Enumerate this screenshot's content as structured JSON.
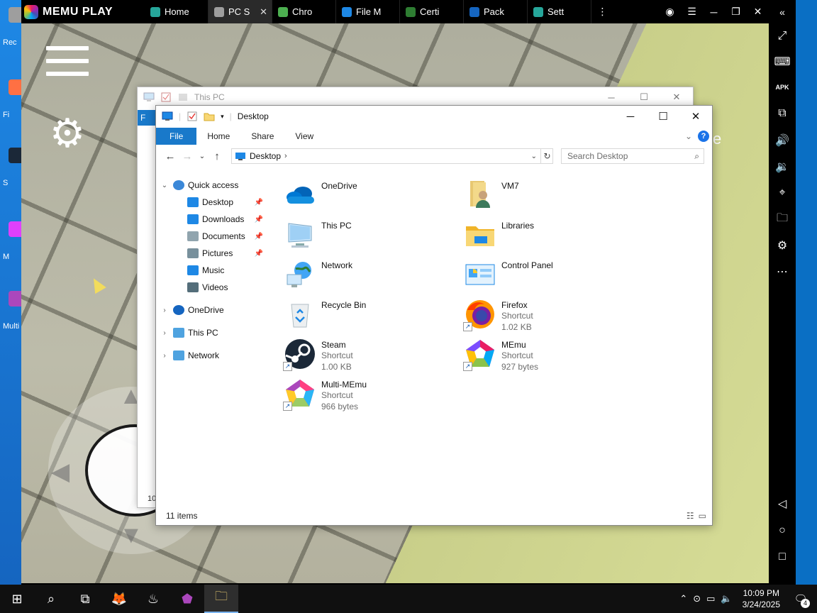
{
  "host_desktop": {
    "icons": [
      {
        "label": "Rec",
        "color": "#9e9e9e"
      },
      {
        "label": "Fi",
        "color": "#ff7043"
      },
      {
        "label": "S",
        "color": "#1b2838"
      },
      {
        "label": "M",
        "color": "#e040fb"
      },
      {
        "label": "Multi",
        "color": "#ab47bc"
      }
    ]
  },
  "memu": {
    "brand": "MEMU PLAY",
    "tabs": [
      {
        "label": "Home",
        "icon": "home-app-icon",
        "color": "#26a69a",
        "active": false
      },
      {
        "label": "PC S",
        "icon": "pc-screen-icon",
        "color": "#9e9e9e",
        "active": true
      },
      {
        "label": "Chro",
        "icon": "chrome-icon",
        "color": "#4caf50",
        "active": false
      },
      {
        "label": "File M",
        "icon": "file-manager-icon",
        "color": "#1e88e5",
        "active": false
      },
      {
        "label": "Certi",
        "icon": "certificate-icon",
        "color": "#2e7d32",
        "active": false
      },
      {
        "label": "Pack",
        "icon": "package-icon",
        "color": "#1565c0",
        "active": false
      },
      {
        "label": "Sett",
        "icon": "settings-app-icon",
        "color": "#26a69a",
        "active": false
      }
    ],
    "close_glyph": "✕",
    "title_buttons": {
      "more": "⋮",
      "account": "◉",
      "menu": "☰",
      "minimize": "─",
      "restore": "❐",
      "close": "✕",
      "collapse": "«"
    },
    "sidebar": [
      "fullscreen-icon",
      "keyboard-icon",
      "apk-icon",
      "multi-window-icon",
      "volume-up-icon",
      "volume-down-icon",
      "location-icon",
      "folder-icon",
      "settings-icon",
      "more-icon",
      "back-icon",
      "home-icon",
      "recents-icon"
    ],
    "sidebar_glyphs": [
      "⤢",
      "⌨",
      "APK",
      "⧉",
      "🔊",
      "🔉",
      "⌖",
      "🗀",
      "⚙",
      "⋯",
      "◁",
      "○",
      "□"
    ]
  },
  "game": {
    "gear": "⚙",
    "ghost_letter": "e"
  },
  "back_window": {
    "title": "This PC",
    "stub_tab": "F",
    "bottom_text": "10",
    "controls": {
      "minimize": "─",
      "maximize": "☐",
      "close": "✕"
    }
  },
  "explorer": {
    "title": "Desktop",
    "controls": {
      "minimize": "─",
      "maximize": "☐",
      "close": "✕"
    },
    "ribbon": {
      "tabs": [
        "File",
        "Home",
        "Share",
        "View"
      ],
      "expand": "⌄",
      "help": "?"
    },
    "nav": {
      "back": "←",
      "forward": "→",
      "recent": "⌄",
      "up": "↑"
    },
    "address": {
      "path": "Desktop",
      "chevron": "›",
      "dropdown": "⌄",
      "refresh": "↻"
    },
    "search": {
      "placeholder": "Search Desktop",
      "icon": "⌕"
    },
    "nav_pane": [
      {
        "label": "Quick access",
        "expander": "⌄",
        "icon": "star-icon",
        "level": 0,
        "pinned": false
      },
      {
        "label": "Desktop",
        "expander": "",
        "icon": "desktop-icon",
        "level": 1,
        "pinned": true
      },
      {
        "label": "Downloads",
        "expander": "",
        "icon": "download-icon",
        "level": 1,
        "pinned": true
      },
      {
        "label": "Documents",
        "expander": "",
        "icon": "document-icon",
        "level": 1,
        "pinned": true
      },
      {
        "label": "Pictures",
        "expander": "",
        "icon": "pictures-icon",
        "level": 1,
        "pinned": true
      },
      {
        "label": "Music",
        "expander": "",
        "icon": "music-icon",
        "level": 1,
        "pinned": false
      },
      {
        "label": "Videos",
        "expander": "",
        "icon": "video-icon",
        "level": 1,
        "pinned": false
      },
      {
        "label": "OneDrive",
        "expander": "›",
        "icon": "cloud-icon",
        "level": 0,
        "pinned": false
      },
      {
        "label": "This PC",
        "expander": "›",
        "icon": "computer-icon",
        "level": 0,
        "pinned": false
      },
      {
        "label": "Network",
        "expander": "›",
        "icon": "network-icon",
        "level": 0,
        "pinned": false
      }
    ],
    "pin_glyph": "📌",
    "items": [
      {
        "name": "OneDrive",
        "sub1": "",
        "sub2": "",
        "icon": "onedrive-icon",
        "col": 0,
        "row": 0,
        "shortcut": false
      },
      {
        "name": "VM7",
        "sub1": "",
        "sub2": "",
        "icon": "user-folder-icon",
        "col": 1,
        "row": 0,
        "shortcut": false
      },
      {
        "name": "This PC",
        "sub1": "",
        "sub2": "",
        "icon": "computer-icon",
        "col": 0,
        "row": 1,
        "shortcut": false
      },
      {
        "name": "Libraries",
        "sub1": "",
        "sub2": "",
        "icon": "libraries-icon",
        "col": 1,
        "row": 1,
        "shortcut": false
      },
      {
        "name": "Network",
        "sub1": "",
        "sub2": "",
        "icon": "network-icon",
        "col": 0,
        "row": 2,
        "shortcut": false
      },
      {
        "name": "Control Panel",
        "sub1": "",
        "sub2": "",
        "icon": "control-panel-icon",
        "col": 1,
        "row": 2,
        "shortcut": false
      },
      {
        "name": "Recycle Bin",
        "sub1": "",
        "sub2": "",
        "icon": "recycle-bin-icon",
        "col": 0,
        "row": 3,
        "shortcut": false
      },
      {
        "name": "Firefox",
        "sub1": "Shortcut",
        "sub2": "1.02 KB",
        "icon": "firefox-icon",
        "col": 1,
        "row": 3,
        "shortcut": true
      },
      {
        "name": "Steam",
        "sub1": "Shortcut",
        "sub2": "1.00 KB",
        "icon": "steam-icon",
        "col": 0,
        "row": 4,
        "shortcut": true
      },
      {
        "name": "MEmu",
        "sub1": "Shortcut",
        "sub2": "927 bytes",
        "icon": "memu-icon",
        "col": 1,
        "row": 4,
        "shortcut": true
      },
      {
        "name": "Multi-MEmu",
        "sub1": "Shortcut",
        "sub2": "966 bytes",
        "icon": "multi-memu-icon",
        "col": 0,
        "row": 5,
        "shortcut": true
      }
    ],
    "status": "11 items",
    "view_toggles": [
      "☷",
      "▭"
    ]
  },
  "taskbar": {
    "buttons": [
      {
        "name": "start-button",
        "glyph": "⊞",
        "active": false
      },
      {
        "name": "search-button",
        "glyph": "⌕",
        "active": false
      },
      {
        "name": "task-view-button",
        "glyph": "⧉",
        "active": false
      },
      {
        "name": "firefox-taskbar-button",
        "glyph": "🦊",
        "active": false
      },
      {
        "name": "steam-taskbar-button",
        "glyph": "♨",
        "active": false
      },
      {
        "name": "memu-taskbar-button",
        "glyph": "⬟",
        "active": false
      },
      {
        "name": "file-explorer-taskbar-button",
        "glyph": "🗀",
        "active": true
      }
    ],
    "tray_glyphs": [
      "⌃",
      "⊙",
      "▭",
      "🔈"
    ],
    "time": "10:09 PM",
    "date": "3/24/2025",
    "notif_glyph": "🗨",
    "notif_count": "4"
  }
}
